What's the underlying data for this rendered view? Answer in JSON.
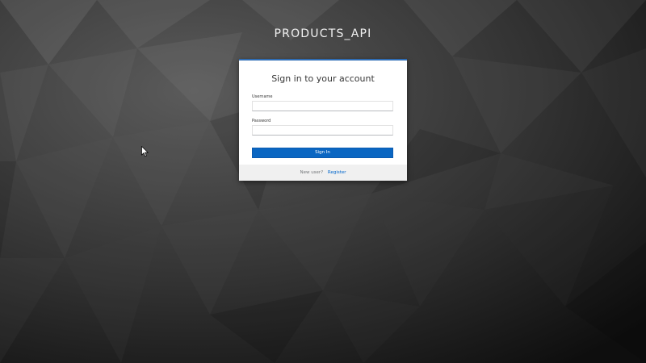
{
  "realm": {
    "title": "PRODUCTS_API"
  },
  "login": {
    "heading": "Sign in to your account",
    "username": {
      "label": "Username",
      "value": "",
      "placeholder": ""
    },
    "password": {
      "label": "Password",
      "value": "",
      "placeholder": ""
    },
    "submit_label": "Sign In"
  },
  "footer": {
    "new_user_text": "New user?",
    "register_label": "Register"
  },
  "colors": {
    "accent": "#0a66c2",
    "card_top_border": "#2f6db5",
    "link": "#0066cc",
    "background": "#2e2e2e"
  },
  "icons": [
    "mouse-cursor-icon"
  ]
}
